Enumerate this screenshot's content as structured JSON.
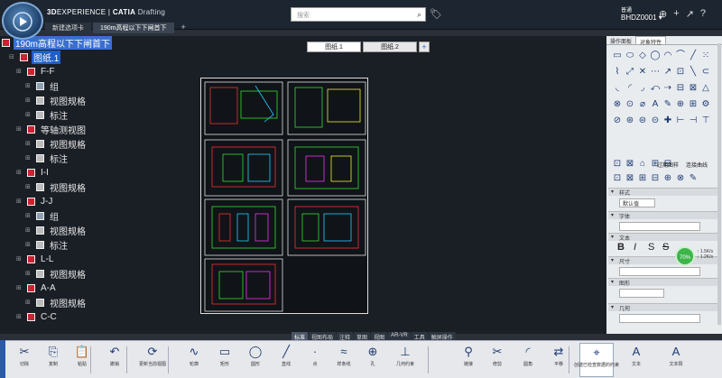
{
  "app": {
    "brand_bold": "3D",
    "brand_rest": "EXPERIENCE | ",
    "product": "CATIA",
    "module": "Drafting",
    "search_placeholder": "搜索",
    "user_role": "普通",
    "user_name": "BHDZ0001 ▾"
  },
  "tabs": [
    {
      "label": "新建选项卡"
    },
    {
      "label": "190m高程以下下闸首下"
    }
  ],
  "tab_add": "+",
  "tree": {
    "root": "190m高程以下下闸首下",
    "sheet": "图纸.1",
    "items": [
      {
        "label": "F-F",
        "level": 1,
        "icon": "view"
      },
      {
        "label": "组",
        "level": 2,
        "icon": "group"
      },
      {
        "label": "视图规格",
        "level": 2,
        "icon": "spec"
      },
      {
        "label": "标注",
        "level": 2,
        "icon": "annot"
      },
      {
        "label": "等轴测视图",
        "level": 1,
        "icon": "view"
      },
      {
        "label": "视图规格",
        "level": 2,
        "icon": "spec"
      },
      {
        "label": "标注",
        "level": 2,
        "icon": "annot"
      },
      {
        "label": "I-I",
        "level": 1,
        "icon": "view"
      },
      {
        "label": "视图规格",
        "level": 2,
        "icon": "spec"
      },
      {
        "label": "J-J",
        "level": 1,
        "icon": "view"
      },
      {
        "label": "组",
        "level": 2,
        "icon": "group"
      },
      {
        "label": "视图规格",
        "level": 2,
        "icon": "spec"
      },
      {
        "label": "标注",
        "level": 2,
        "icon": "annot"
      },
      {
        "label": "L-L",
        "level": 1,
        "icon": "view"
      },
      {
        "label": "视图规格",
        "level": 2,
        "icon": "spec"
      },
      {
        "label": "A-A",
        "level": 1,
        "icon": "view"
      },
      {
        "label": "视图规格",
        "level": 2,
        "icon": "spec"
      },
      {
        "label": "C-C",
        "level": 1,
        "icon": "view"
      }
    ]
  },
  "sheets": [
    {
      "label": "图纸.1"
    },
    {
      "label": "图纸.2"
    }
  ],
  "sheet_add": "+",
  "right_panel": {
    "tabs": [
      "操作面板",
      "对象特性"
    ],
    "text_label1": "过期图样",
    "text_label2": "连接曲线",
    "section_style": "样式",
    "style_value": "默认值",
    "section_font": "字体",
    "section_text": "文本",
    "section_size": "尺寸",
    "section_graphic": "图形",
    "section_geometry": "几何",
    "text_bold": "B",
    "text_italic": "I",
    "text_s1": "S",
    "text_s2": "S",
    "badge": "70%",
    "speed_up": "↑ 1.5K/s",
    "speed_down": "↓ 1.2K/s"
  },
  "action_tabs": [
    "标准",
    "视图布局",
    "注释",
    "草图",
    "视图",
    "AR-VR",
    "工具",
    "触屏操作"
  ],
  "action_buttons": [
    {
      "label": "切除",
      "icon": "✂"
    },
    {
      "label": "复制",
      "icon": "⎘"
    },
    {
      "label": "粘贴",
      "icon": "📋"
    },
    {
      "label": "撤销",
      "icon": "↶"
    },
    {
      "label": "更新当前视图",
      "icon": "⟳"
    },
    {
      "label": "轮廓",
      "icon": "∿"
    },
    {
      "label": "矩形",
      "icon": "▭"
    },
    {
      "label": "圆形",
      "icon": "◯"
    },
    {
      "label": "直线",
      "icon": "╱"
    },
    {
      "label": "点",
      "icon": "·"
    },
    {
      "label": "样条线",
      "icon": "≈"
    },
    {
      "label": "孔",
      "icon": "⊕"
    },
    {
      "label": "几何约束",
      "icon": "⊥"
    },
    {
      "label": "链接",
      "icon": "⚲"
    },
    {
      "label": "修剪",
      "icon": "✂"
    },
    {
      "label": "圆角",
      "icon": "◜"
    },
    {
      "label": "平移",
      "icon": "⇄"
    },
    {
      "label": "创建已检查数据的约束",
      "icon": "⌖"
    },
    {
      "label": "文本",
      "icon": "A"
    },
    {
      "label": "文本阳",
      "icon": "A"
    }
  ],
  "colors": {
    "accent": "#1e5fc9",
    "topbar": "#1d2530",
    "workspace": "#1a1f26",
    "panel": "#e9ecef"
  }
}
